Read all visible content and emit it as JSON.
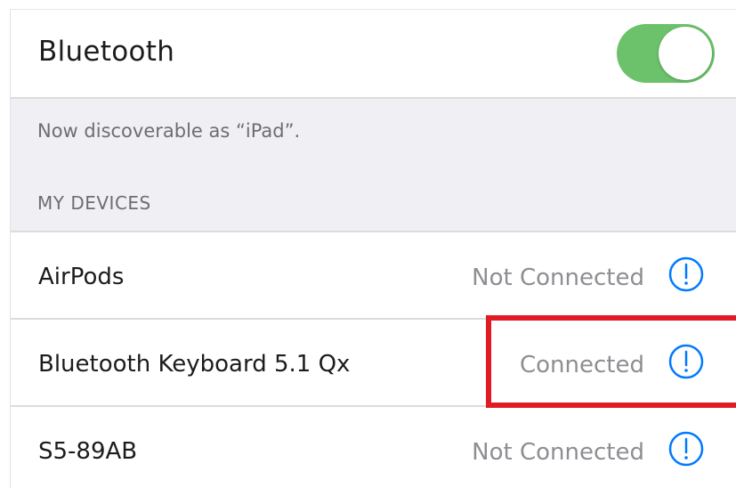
{
  "settings": {
    "bluetooth_label": "Bluetooth",
    "bluetooth_enabled": true,
    "discoverable_text": "Now discoverable as “iPad”.",
    "section_title": "MY DEVICES"
  },
  "devices": [
    {
      "name": "AirPods",
      "status": "Not Connected",
      "info_icon": "info-icon"
    },
    {
      "name": "Bluetooth Keyboard 5.1 Qx",
      "status": "Connected",
      "info_icon": "info-icon"
    },
    {
      "name": "S5-89AB",
      "status": "Not Connected",
      "info_icon": "info-icon"
    }
  ],
  "colors": {
    "toggle_on": "#6cc26b",
    "accent": "#007aff",
    "highlight": "#e01b24"
  }
}
